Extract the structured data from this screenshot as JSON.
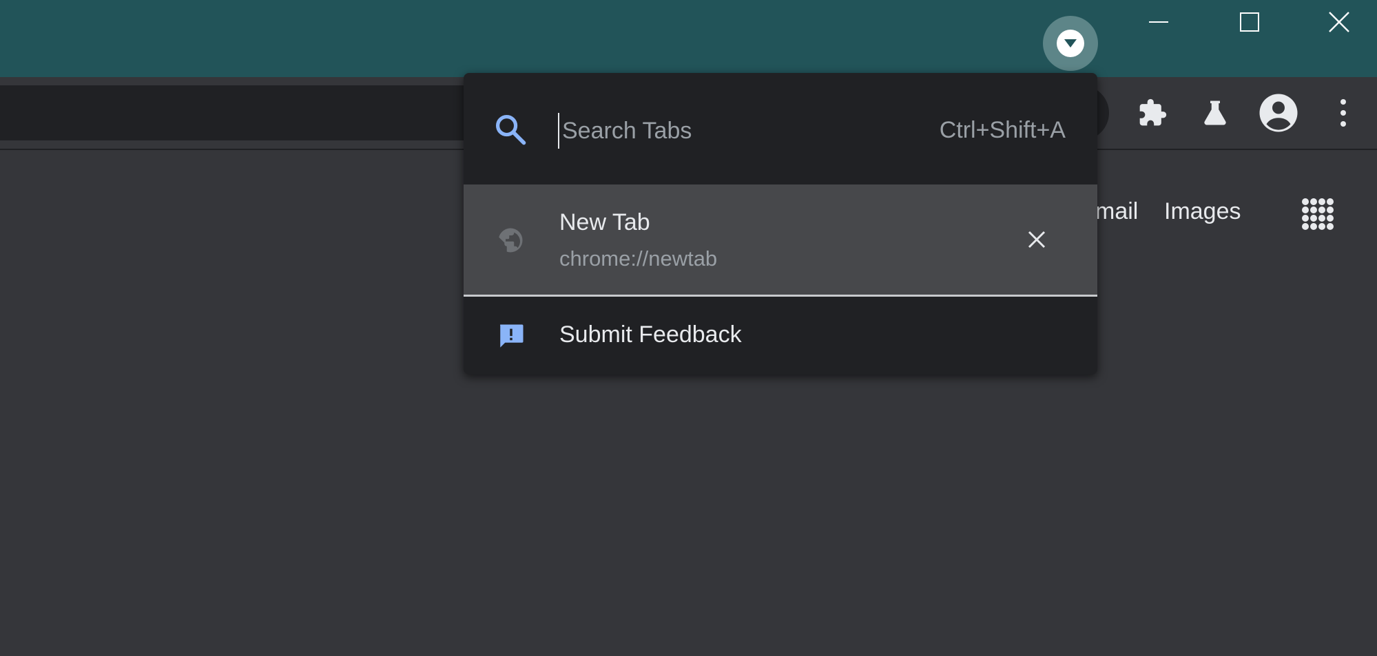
{
  "window_controls": {
    "minimize_icon": "minimize-icon",
    "maximize_icon": "maximize-icon",
    "close_icon": "close-icon"
  },
  "tab_search_button": {
    "icon": "chevron-down-icon"
  },
  "toolbar": {
    "icons": [
      "extensions-icon",
      "labs-icon",
      "profile-icon",
      "more-vert-icon"
    ]
  },
  "ntp": {
    "gmail_link": "mail",
    "images_link": "Images",
    "apps_icon": "apps-grid-icon"
  },
  "tab_search": {
    "placeholder": "Search Tabs",
    "value": "",
    "shortcut": "Ctrl+Shift+A",
    "tabs": [
      {
        "title": "New Tab",
        "url": "chrome://newtab",
        "favicon": "globe-icon"
      }
    ],
    "feedback_label": "Submit Feedback"
  },
  "colors": {
    "titlebar": "#225459",
    "accent": "#8ab4f8",
    "popup_bg": "#202124",
    "selected_row": "#47484b"
  }
}
